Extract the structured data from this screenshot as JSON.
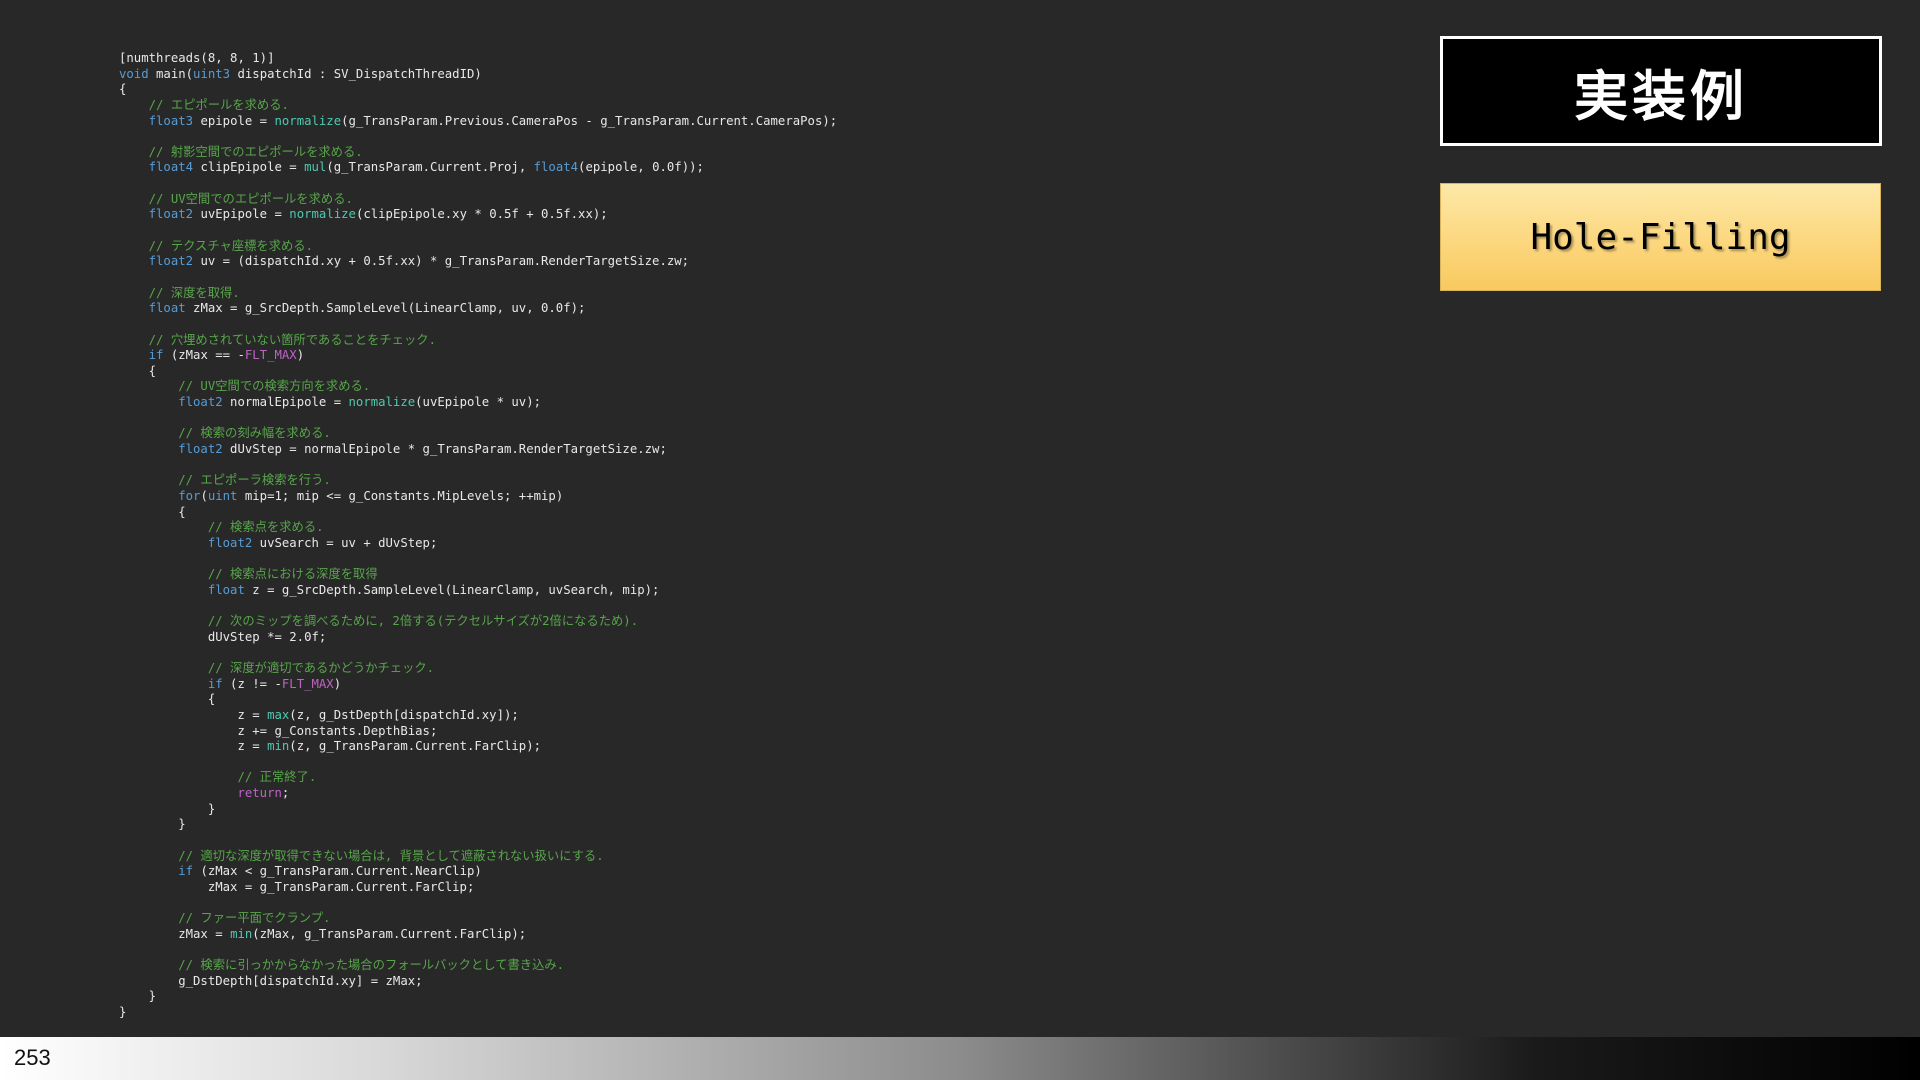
{
  "slide": {
    "title": "実装例",
    "subtitle": "Hole-Filling",
    "page_number": "253",
    "colors": {
      "background": "#282828",
      "code_text": "#e8e8e8",
      "comment": "#57a64a",
      "keyword": "#569cd6",
      "function": "#4ec9b0",
      "macro": "#bd63c5",
      "subtitle_fill": "#fcd77e"
    }
  },
  "code_lines": [
    [
      [
        "p",
        "[numthreads(8, 8, 1)]"
      ]
    ],
    [
      [
        "k",
        "void"
      ],
      [
        "p",
        " main("
      ],
      [
        "k",
        "uint3"
      ],
      [
        "p",
        " dispatchId : SV_DispatchThreadID)"
      ]
    ],
    [
      [
        "p",
        "{"
      ]
    ],
    [
      [
        "c",
        "    // エピポールを求める."
      ]
    ],
    [
      [
        "k",
        "    float3"
      ],
      [
        "p",
        " epipole = "
      ],
      [
        "f",
        "normalize"
      ],
      [
        "p",
        "(g_TransParam.Previous.CameraPos - g_TransParam.Current.CameraPos);"
      ]
    ],
    [],
    [
      [
        "c",
        "    // 射影空間でのエピポールを求める."
      ]
    ],
    [
      [
        "k",
        "    float4"
      ],
      [
        "p",
        " clipEpipole = "
      ],
      [
        "f",
        "mul"
      ],
      [
        "p",
        "(g_TransParam.Current.Proj, "
      ],
      [
        "k",
        "float4"
      ],
      [
        "p",
        "(epipole, 0.0f));"
      ]
    ],
    [],
    [
      [
        "c",
        "    // UV空間でのエピポールを求める."
      ]
    ],
    [
      [
        "k",
        "    float2"
      ],
      [
        "p",
        " uvEpipole = "
      ],
      [
        "f",
        "normalize"
      ],
      [
        "p",
        "(clipEpipole.xy * 0.5f + 0.5f.xx);"
      ]
    ],
    [],
    [
      [
        "c",
        "    // テクスチャ座標を求める."
      ]
    ],
    [
      [
        "k",
        "    float2"
      ],
      [
        "p",
        " uv = (dispatchId.xy + 0.5f.xx) * g_TransParam.RenderTargetSize.zw;"
      ]
    ],
    [],
    [
      [
        "c",
        "    // 深度を取得."
      ]
    ],
    [
      [
        "k",
        "    float"
      ],
      [
        "p",
        " zMax = g_SrcDepth.SampleLevel(LinearClamp, uv, 0.0f);"
      ]
    ],
    [],
    [
      [
        "c",
        "    // 穴埋めされていない箇所であることをチェック."
      ]
    ],
    [
      [
        "k",
        "    if"
      ],
      [
        "p",
        " (zMax == -"
      ],
      [
        "m",
        "FLT_MAX"
      ],
      [
        "p",
        ")"
      ]
    ],
    [
      [
        "p",
        "    {"
      ]
    ],
    [
      [
        "c",
        "        // UV空間での検索方向を求める."
      ]
    ],
    [
      [
        "k",
        "        float2"
      ],
      [
        "p",
        " normalEpipole = "
      ],
      [
        "f",
        "normalize"
      ],
      [
        "p",
        "(uvEpipole * uv);"
      ]
    ],
    [],
    [
      [
        "c",
        "        // 検索の刻み幅を求める."
      ]
    ],
    [
      [
        "k",
        "        float2"
      ],
      [
        "p",
        " dUvStep = normalEpipole * g_TransParam.RenderTargetSize.zw;"
      ]
    ],
    [],
    [
      [
        "c",
        "        // エピポーラ検索を行う."
      ]
    ],
    [
      [
        "k",
        "        for"
      ],
      [
        "p",
        "("
      ],
      [
        "k",
        "uint"
      ],
      [
        "p",
        " mip=1; mip <= g_Constants.MipLevels; ++mip)"
      ]
    ],
    [
      [
        "p",
        "        {"
      ]
    ],
    [
      [
        "c",
        "            // 検索点を求める."
      ]
    ],
    [
      [
        "k",
        "            float2"
      ],
      [
        "p",
        " uvSearch = uv + dUvStep;"
      ]
    ],
    [],
    [
      [
        "c",
        "            // 検索点における深度を取得"
      ]
    ],
    [
      [
        "k",
        "            float"
      ],
      [
        "p",
        " z = g_SrcDepth.SampleLevel(LinearClamp, uvSearch, mip);"
      ]
    ],
    [],
    [
      [
        "c",
        "            // 次のミップを調べるために, 2倍する(テクセルサイズが2倍になるため)."
      ]
    ],
    [
      [
        "p",
        "            dUvStep *= 2.0f;"
      ]
    ],
    [],
    [
      [
        "c",
        "            // 深度が適切であるかどうかチェック."
      ]
    ],
    [
      [
        "k",
        "            if"
      ],
      [
        "p",
        " (z != -"
      ],
      [
        "m",
        "FLT_MAX"
      ],
      [
        "p",
        ")"
      ]
    ],
    [
      [
        "p",
        "            {"
      ]
    ],
    [
      [
        "p",
        "                z = "
      ],
      [
        "f",
        "max"
      ],
      [
        "p",
        "(z, g_DstDepth[dispatchId.xy]);"
      ]
    ],
    [
      [
        "p",
        "                z += g_Constants.DepthBias;"
      ]
    ],
    [
      [
        "p",
        "                z = "
      ],
      [
        "f",
        "min"
      ],
      [
        "p",
        "(z, g_TransParam.Current.FarClip);"
      ]
    ],
    [],
    [
      [
        "c",
        "                // 正常終了."
      ]
    ],
    [
      [
        "m",
        "                return"
      ],
      [
        "p",
        ";"
      ]
    ],
    [
      [
        "p",
        "            }"
      ]
    ],
    [
      [
        "p",
        "        }"
      ]
    ],
    [],
    [
      [
        "c",
        "        // 適切な深度が取得できない場合は, 背景として遮蔽されない扱いにする."
      ]
    ],
    [
      [
        "k",
        "        if"
      ],
      [
        "p",
        " (zMax < g_TransParam.Current.NearClip)"
      ]
    ],
    [
      [
        "p",
        "            zMax = g_TransParam.Current.FarClip;"
      ]
    ],
    [],
    [
      [
        "c",
        "        // ファー平面でクランプ."
      ]
    ],
    [
      [
        "p",
        "        zMax = "
      ],
      [
        "f",
        "min"
      ],
      [
        "p",
        "(zMax, g_TransParam.Current.FarClip);"
      ]
    ],
    [],
    [
      [
        "c",
        "        // 検索に引っかからなかった場合のフォールバックとして書き込み."
      ]
    ],
    [
      [
        "p",
        "        g_DstDepth[dispatchId.xy] = zMax;"
      ]
    ],
    [
      [
        "p",
        "    }"
      ]
    ],
    [
      [
        "p",
        "}"
      ]
    ]
  ]
}
